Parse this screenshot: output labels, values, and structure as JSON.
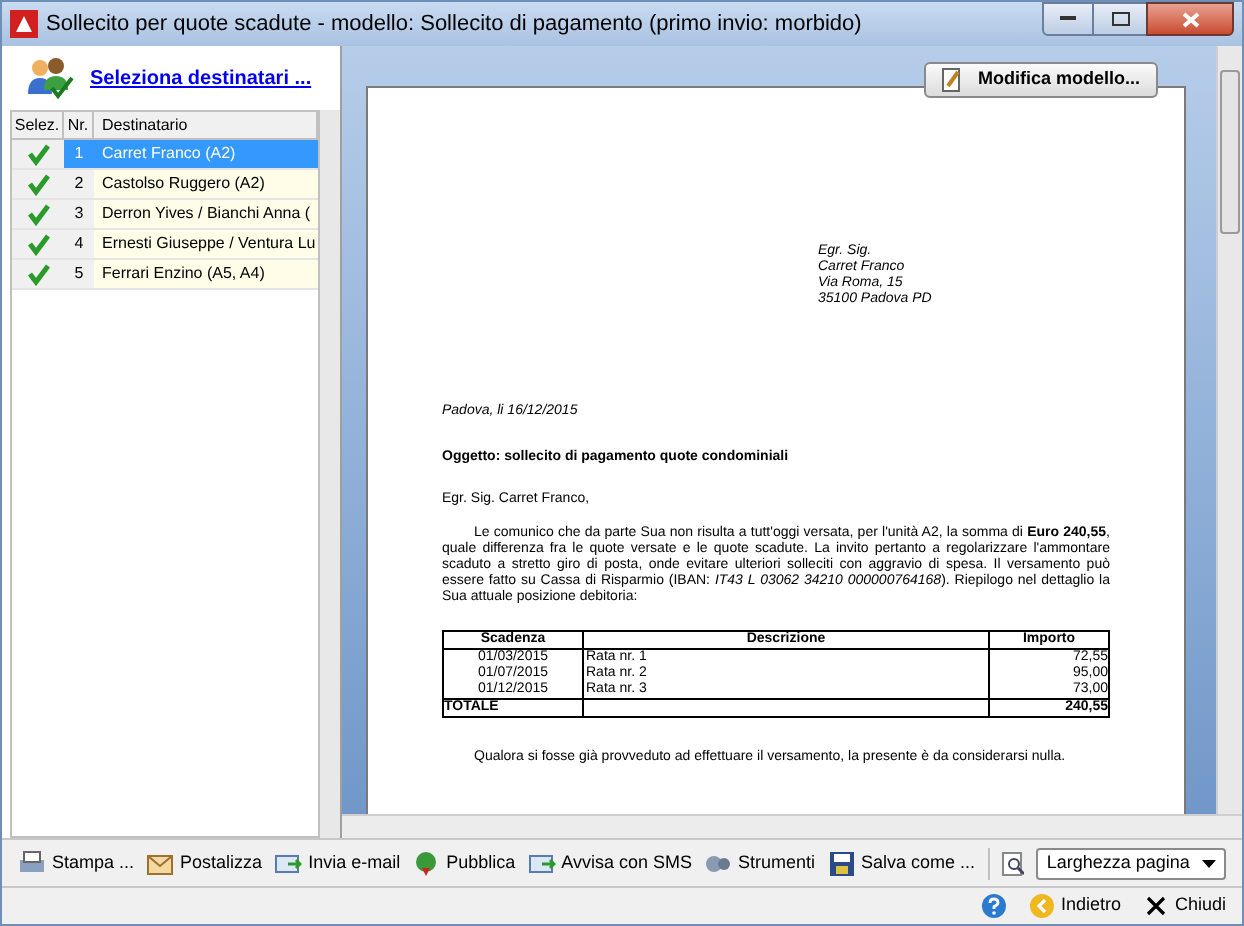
{
  "window": {
    "title": "Sollecito per quote scadute - modello: Sollecito di pagamento (primo invio: morbido)"
  },
  "left_panel": {
    "select_link": "Seleziona destinatari ..."
  },
  "recipients": {
    "columns": [
      "Selez.",
      "Nr.",
      "Destinatario"
    ],
    "rows": [
      {
        "checked": true,
        "nr": "1",
        "name": "Carret Franco (A2)",
        "selected": true
      },
      {
        "checked": true,
        "nr": "2",
        "name": "Castolso Ruggero (A2)",
        "selected": false
      },
      {
        "checked": true,
        "nr": "3",
        "name": "Derron Yives / Bianchi Anna (",
        "selected": false
      },
      {
        "checked": true,
        "nr": "4",
        "name": "Ernesti Giuseppe / Ventura Lu",
        "selected": false
      },
      {
        "checked": true,
        "nr": "5",
        "name": "Ferrari Enzino (A5, A4)",
        "selected": false
      }
    ]
  },
  "preview": {
    "edit_button": "Modifica modello...",
    "letter": {
      "address_lines": [
        "Egr. Sig.",
        "Carret Franco",
        "Via Roma, 15",
        "35100 Padova PD"
      ],
      "date": "Padova, li 16/12/2015",
      "subject": "Oggetto: sollecito di pagamento quote condominiali",
      "greeting": "Egr. Sig. Carret Franco,",
      "paragraph": "Le comunico che da parte Sua non risulta a tutt'oggi versata, per l'unità A2, la somma di **Euro 240,55**, quale differenza fra le quote versate e le quote scadute. La invito pertanto a regolarizzare l'ammontare scaduto a stretto giro di posta, onde evitare ulteriori solleciti con aggravio di spesa. Il versamento può essere fatto su Cassa di Risparmio (IBAN: *IT43 L 03062 34210 000000764168*). Riepilogo nel dettaglio la Sua attuale posizione debitoria:",
      "table": {
        "columns": [
          "Scadenza",
          "Descrizione",
          "Importo"
        ],
        "rows": [
          [
            "01/03/2015",
            "Rata nr. 1",
            "72,55"
          ],
          [
            "01/07/2015",
            "Rata nr. 2",
            "95,00"
          ],
          [
            "01/12/2015",
            "Rata nr. 3",
            "73,00"
          ]
        ],
        "total": {
          "label": "TOTALE",
          "amount": "240,55"
        }
      },
      "closing": "Qualora si fosse già provveduto ad effettuare il versamento, la presente è da considerarsi nulla."
    }
  },
  "toolbar": {
    "items": [
      {
        "kind": "print",
        "label": "Stampa ..."
      },
      {
        "kind": "mail",
        "label": "Postalizza"
      },
      {
        "kind": "email",
        "label": "Invia e-mail"
      },
      {
        "kind": "publish",
        "label": "Pubblica"
      },
      {
        "kind": "sms",
        "label": "Avvisa con SMS"
      },
      {
        "kind": "tools",
        "label": "Strumenti"
      },
      {
        "kind": "save",
        "label": "Salva come ..."
      }
    ],
    "zoom_select": "Larghezza pagina"
  },
  "footer": {
    "buttons": [
      {
        "kind": "back",
        "label": "Indietro"
      },
      {
        "kind": "close",
        "label": "Chiudi"
      }
    ]
  }
}
